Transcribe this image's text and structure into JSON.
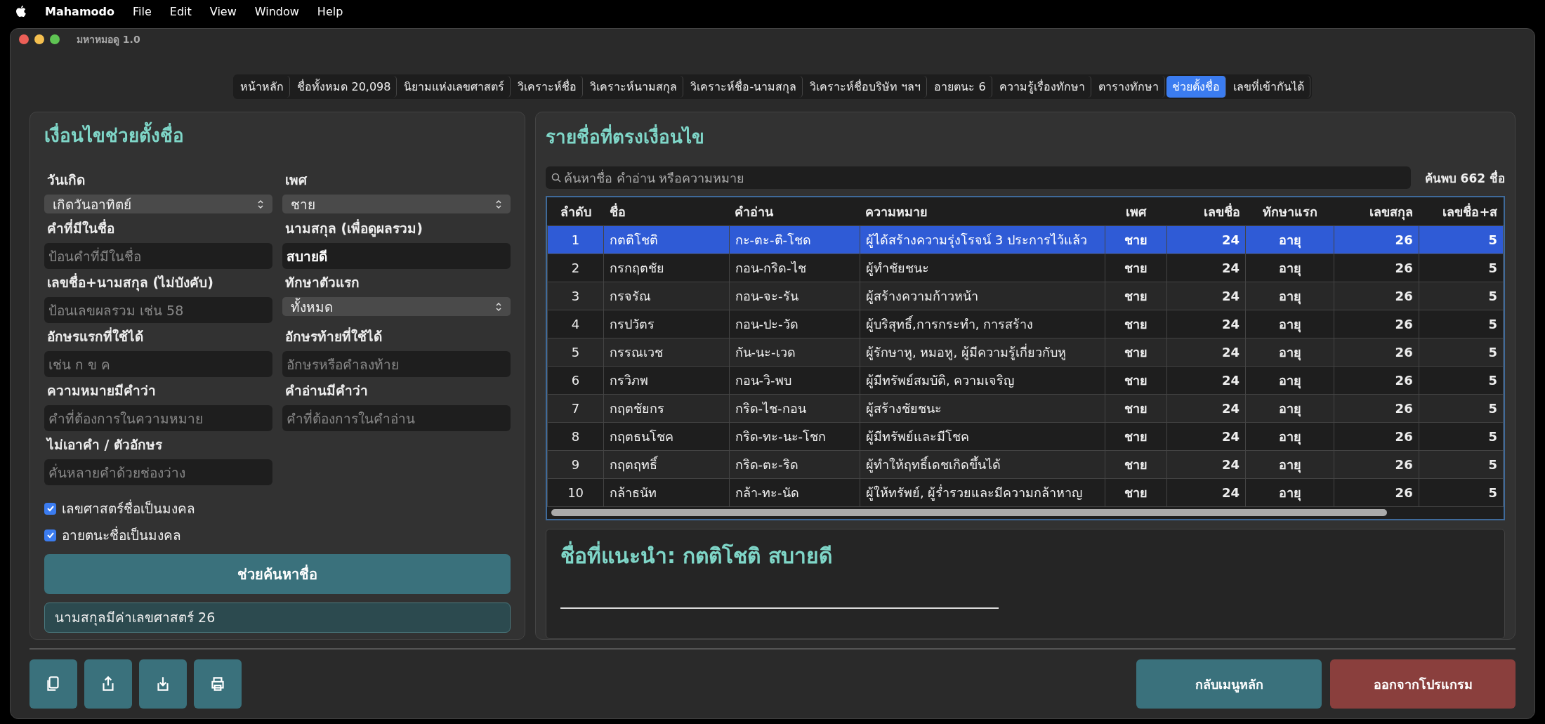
{
  "menu_bar": {
    "items": [
      "Mahamodo",
      "File",
      "Edit",
      "View",
      "Window",
      "Help"
    ]
  },
  "window": {
    "title": "มหาหมอดู 1.0"
  },
  "tabs": [
    {
      "label": "หน้าหลัก",
      "selected": false
    },
    {
      "label": "ชื่อทั้งหมด 20,098",
      "selected": false
    },
    {
      "label": "นิยามแห่งเลขศาสตร์",
      "selected": false
    },
    {
      "label": "วิเคราะห์ชื่อ",
      "selected": false
    },
    {
      "label": "วิเคราะห์นามสกุล",
      "selected": false
    },
    {
      "label": "วิเคราะห์ชื่อ-นามสกุล",
      "selected": false
    },
    {
      "label": "วิเคราะห์ชื่อบริษัท ฯลฯ",
      "selected": false
    },
    {
      "label": "อายตนะ 6",
      "selected": false
    },
    {
      "label": "ความรู้เรื่องทักษา",
      "selected": false
    },
    {
      "label": "ตารางทักษา",
      "selected": false
    },
    {
      "label": "ช่วยตั้งชื่อ",
      "selected": true
    },
    {
      "label": "เลขที่เข้ากันได้",
      "selected": false
    }
  ],
  "conditions": {
    "title": "เงื่อนไขช่วยตั้งชื่อ",
    "fields": [
      {
        "kind": "select",
        "label": "วันเกิด",
        "value": "เกิดวันอาทิตย์"
      },
      {
        "kind": "select",
        "label": "เพศ",
        "value": "ชาย"
      },
      {
        "kind": "input",
        "label": "คำที่มีในชื่อ",
        "placeholder": "ป้อนคำที่มีในชื่อ"
      },
      {
        "kind": "input",
        "label": "นามสกุล (เพื่อดูผลรวม)",
        "value": "สบายดี"
      },
      {
        "kind": "input",
        "label": "เลขชื่อ+นามสกุล (ไม่บังคับ)",
        "placeholder": "ป้อนเลขผลรวม เช่น 58"
      },
      {
        "kind": "select",
        "label": "ทักษาตัวแรก",
        "value": "ทั้งหมด"
      },
      {
        "kind": "input",
        "label": "อักษรแรกที่ใช้ได้",
        "placeholder": "เช่น ก ข ค"
      },
      {
        "kind": "input",
        "label": "อักษรท้ายที่ใช้ได้",
        "placeholder": "อักษรหรือคำลงท้าย"
      },
      {
        "kind": "input",
        "label": "ความหมายมีคำว่า",
        "placeholder": "คำที่ต้องการในความหมาย"
      },
      {
        "kind": "input",
        "label": "คำอ่านมีคำว่า",
        "placeholder": "คำที่ต้องการในคำอ่าน"
      },
      {
        "kind": "input",
        "label": "ไม่เอาคำ / ตัวอักษร",
        "placeholder": "คั่นหลายคำด้วยช่องว่าง"
      }
    ],
    "checkboxes": [
      {
        "label": "เลขศาสตร์ชื่อเป็นมงคล",
        "checked": true
      },
      {
        "label": "อายตนะชื่อเป็นมงคล",
        "checked": true
      }
    ],
    "search_button": "ช่วยค้นหาชื่อ",
    "result_note": "นามสกุลมีค่าเลขศาสตร์ 26"
  },
  "results": {
    "title": "รายชื่อที่ตรงเงื่อนไข",
    "search_placeholder": "ค้นหาชื่อ คำอ่าน หรือความหมาย",
    "count": "ค้นพบ 662 ชื่อ",
    "columns": [
      "ลำดับ",
      "ชื่อ",
      "คำอ่าน",
      "ความหมาย",
      "เพศ",
      "เลขชื่อ",
      "ทักษาแรก",
      "เลขสกุล",
      "เลขชื่อ+ส"
    ],
    "rows": [
      {
        "cells": [
          "1",
          "กตติโชติ",
          "กะ-ตะ-ติ-โชด",
          "ผู้ได้สร้างความรุ่งโรจน์ 3 ประการไว้แล้ว",
          "ชาย",
          "24",
          "อายุ",
          "26",
          "5"
        ],
        "selected": true
      },
      {
        "cells": [
          "2",
          "กรกฤตชัย",
          "กอน-กริด-ไช",
          "ผู้ทำชัยชนะ",
          "ชาย",
          "24",
          "อายุ",
          "26",
          "5"
        ],
        "selected": false
      },
      {
        "cells": [
          "3",
          "กรจรัณ",
          "กอน-จะ-รัน",
          "ผู้สร้างความก้าวหน้า",
          "ชาย",
          "24",
          "อายุ",
          "26",
          "5"
        ],
        "selected": false
      },
      {
        "cells": [
          "4",
          "กรปวัตร",
          "กอน-ปะ-วัด",
          "ผู้บริสุทธิ์,การกระทำ, การสร้าง",
          "ชาย",
          "24",
          "อายุ",
          "26",
          "5"
        ],
        "selected": false
      },
      {
        "cells": [
          "5",
          "กรรณเวช",
          "กัน-นะ-เวด",
          "ผู้รักษาหู, หมอหู, ผู้มีความรู้เกี่ยวกับหู",
          "ชาย",
          "24",
          "อายุ",
          "26",
          "5"
        ],
        "selected": false
      },
      {
        "cells": [
          "6",
          "กรวิภพ",
          "กอน-วิ-พบ",
          "ผู้มีทรัพย์สมบัติ, ความเจริญ",
          "ชาย",
          "24",
          "อายุ",
          "26",
          "5"
        ],
        "selected": false
      },
      {
        "cells": [
          "7",
          "กฤตชัยกร",
          "กริด-ไช-กอน",
          "ผู้สร้างชัยชนะ",
          "ชาย",
          "24",
          "อายุ",
          "26",
          "5"
        ],
        "selected": false
      },
      {
        "cells": [
          "8",
          "กฤตธนโชค",
          "กริด-ทะ-นะ-โชก",
          "ผู้มีทรัพย์และมีโชค",
          "ชาย",
          "24",
          "อายุ",
          "26",
          "5"
        ],
        "selected": false
      },
      {
        "cells": [
          "9",
          "กฤตฤทธิ์",
          "กริด-ตะ-ริด",
          "ผู้ทำให้ฤทธิ์เดชเกิดขึ้นได้",
          "ชาย",
          "24",
          "อายุ",
          "26",
          "5"
        ],
        "selected": false
      },
      {
        "cells": [
          "10",
          "กล้าธนัท",
          "กล้า-ทะ-นัด",
          "ผู้ให้ทรัพย์, ผู้ร่ำรวยและมีความกล้าหาญ",
          "ชาย",
          "24",
          "อายุ",
          "26",
          "5"
        ],
        "selected": false
      }
    ]
  },
  "suggestion": {
    "title": "ชื่อที่แนะนำ: กตติโชติ สบายดี"
  },
  "footer": {
    "tools": [
      {
        "kind": "copy"
      },
      {
        "kind": "share"
      },
      {
        "kind": "download"
      },
      {
        "kind": "print"
      }
    ],
    "buttons": [
      {
        "kind": "primary",
        "label": "กลับเมนูหลัก"
      },
      {
        "kind": "danger",
        "label": "ออกจากโปรแกรม"
      }
    ]
  }
}
